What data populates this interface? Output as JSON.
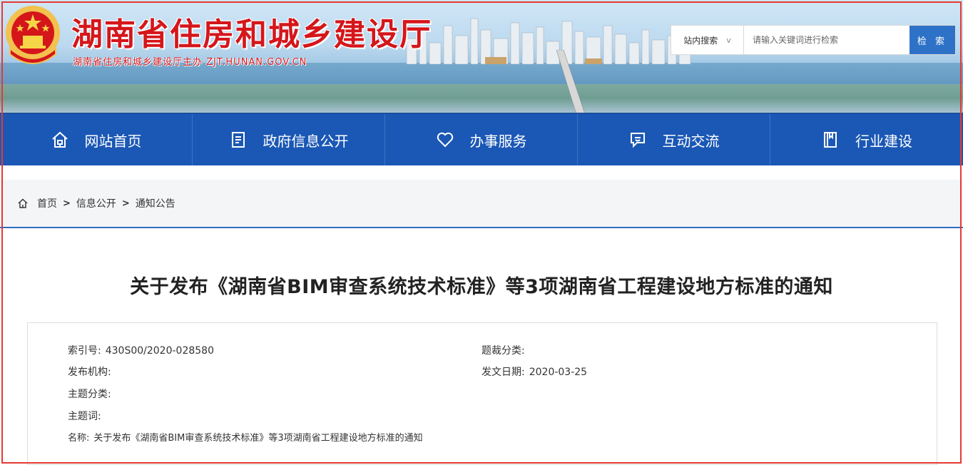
{
  "header": {
    "site_title": "湖南省住房和城乡建设厅",
    "site_subtitle": "湖南省住房和城乡建设厅主办  ZJT.HUNAN.GOV.CN",
    "search": {
      "scope": "站内搜索",
      "scope_chevron": "v",
      "placeholder": "请输入关键词进行检索",
      "button": "检 索"
    }
  },
  "nav": {
    "items": [
      {
        "label": "网站首页",
        "icon": "home-icon"
      },
      {
        "label": "政府信息公开",
        "icon": "document-icon"
      },
      {
        "label": "办事服务",
        "icon": "heart-icon"
      },
      {
        "label": "互动交流",
        "icon": "chat-icon"
      },
      {
        "label": "行业建设",
        "icon": "book-icon"
      }
    ]
  },
  "breadcrumb": {
    "items": [
      "首页",
      "信息公开",
      "通知公告"
    ],
    "sep": ">"
  },
  "article": {
    "title": "关于发布《湖南省BIM审查系统技术标准》等3项湖南省工程建设地方标准的通知",
    "meta": {
      "index_label": "索引号:",
      "index_value": "430S00/2020-028580",
      "genre_label": "题裁分类:",
      "genre_value": "",
      "publisher_label": "发布机构:",
      "publisher_value": "",
      "date_label": "发文日期:",
      "date_value": "2020-03-25",
      "topic_label": "主题分类:",
      "topic_value": "",
      "keyword_label": "主题词:",
      "keyword_value": "",
      "name_label": "名称:",
      "name_value": "关于发布《湖南省BIM审查系统技术标准》等3项湖南省工程建设地方标准的通知"
    }
  },
  "colors": {
    "brand_red": "#d4161b",
    "nav_blue": "#1b58b5",
    "search_blue": "#2e72c7",
    "frame_red": "#e53935"
  }
}
